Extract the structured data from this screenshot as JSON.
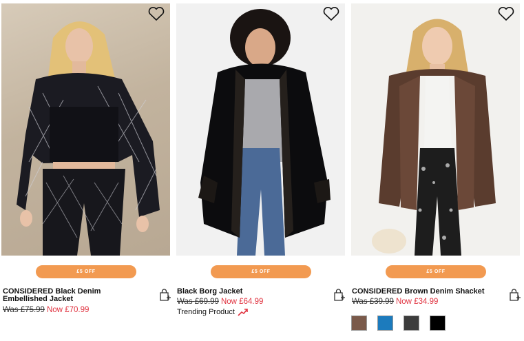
{
  "products": [
    {
      "title": "CONSIDERED Black Denim Embellished Jacket",
      "badge": "£5 OFF",
      "was_label": "Was",
      "was_price": "£75.99",
      "now_label": "Now",
      "now_price": "£70.99",
      "photo": "woman-black-embellished-denim-jacket"
    },
    {
      "title": "Black Borg Jacket",
      "badge": "£5 OFF",
      "was_label": "Was",
      "was_price": "£69.99",
      "now_label": "Now",
      "now_price": "£64.99",
      "trending": "Trending Product",
      "photo": "woman-black-borg-jacket"
    },
    {
      "title": "CONSIDERED Brown Denim Shacket",
      "badge": "£5 OFF",
      "was_label": "Was",
      "was_price": "£39.99",
      "now_label": "Now",
      "now_price": "£34.99",
      "photo": "woman-brown-denim-shacket",
      "swatches": [
        "#7a5a4a",
        "#1c7bbd",
        "#3c3c3c",
        "#000000"
      ]
    }
  ],
  "colors": {
    "badge": "#f29a51",
    "now_price": "#e0323f",
    "trend_icon": "#e0323f"
  },
  "icons": {
    "wishlist": "heart-outline-icon",
    "add_to_bag": "bag-plus-icon",
    "trending": "trending-up-icon"
  }
}
